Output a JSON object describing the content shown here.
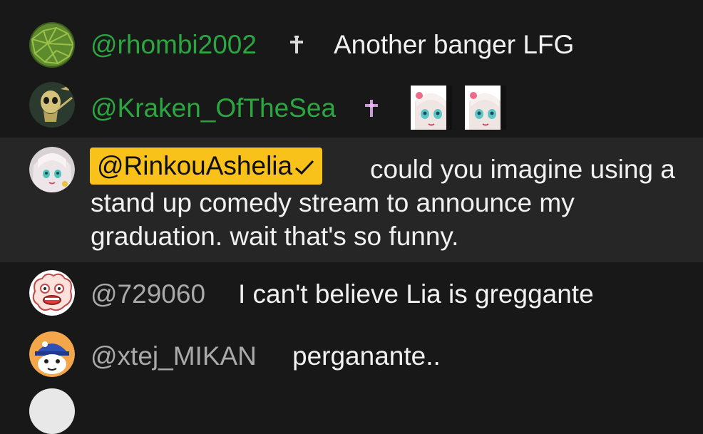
{
  "chat": {
    "messages": [
      {
        "author": "@rhombi2002",
        "text": "Another banger LFG",
        "badge": "member-cross-badge-icon",
        "author_color": "#2ba640"
      },
      {
        "author": "@Kraken_OfTheSea",
        "text": "",
        "badge": "member-cross-badge-icon",
        "emotes": [
          "anime-girl-emote-icon",
          "anime-girl-emote-icon"
        ],
        "author_color": "#2ba640"
      },
      {
        "author": "@RinkouAshelia",
        "role": "owner",
        "text": "could you imagine using a stand up comedy stream to announce my graduation. wait that's so funny.",
        "badge": "verified-check-icon",
        "chip_color": "#f8c21b"
      },
      {
        "author": "@729060",
        "text": "I can't believe Lia is greggante",
        "author_color": "#aaaaaa"
      },
      {
        "author": "@xtej_MIKAN",
        "text": "perganante..",
        "author_color": "#aaaaaa"
      }
    ]
  },
  "colors": {
    "background": "#181818",
    "highlight_row": "#262626",
    "member_name": "#2ba640",
    "plain_name": "#aaaaaa",
    "owner_chip": "#f8c21b"
  }
}
